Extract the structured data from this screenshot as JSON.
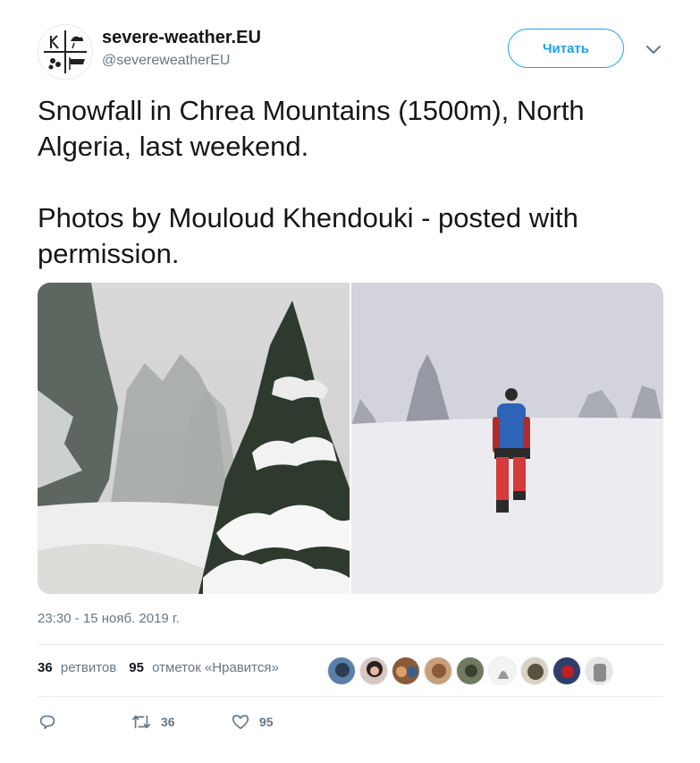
{
  "author": {
    "name": "severe-weather.EU",
    "handle": "@severeweatherEU"
  },
  "follow_label": "Читать",
  "tweet": {
    "text": "Snowfall in Chrea Mountains (1500m), North Algeria, last weekend.\n\nPhotos by Mouloud Khendouki - posted with permission."
  },
  "timestamp": "23:30 - 15 нояб. 2019 г.",
  "stats": {
    "retweets_count": "36",
    "retweets_label": "ретвитов",
    "likes_count": "95",
    "likes_label": "отметок «Нравится»"
  },
  "actions": {
    "retweet_count": "36",
    "like_count": "95"
  },
  "colors": {
    "accent": "#1da1f2",
    "text": "#14171a",
    "muted": "#657786",
    "divider": "#e6ecf0"
  },
  "icons": [
    "logo-icon",
    "chevron-down-icon",
    "reply-icon",
    "retweet-icon",
    "like-icon"
  ]
}
